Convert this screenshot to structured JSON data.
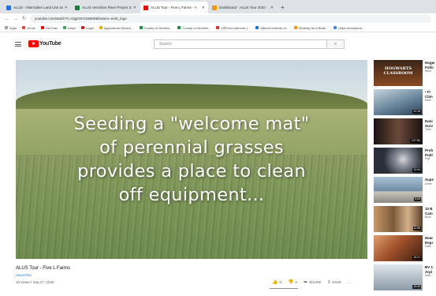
{
  "browser": {
    "tabs": [
      {
        "title": "ALUS - Alternative Land Use Ser",
        "color": "#1a73e8",
        "active": false
      },
      {
        "title": "ALUS Vermilion River Project St",
        "color": "#188038",
        "active": false
      },
      {
        "title": "ALUS Tour - Five L Farms - Y",
        "color": "#ff0000",
        "active": true
      },
      {
        "title": "Dashboard · ALUS Tour 2020",
        "color": "#f29900",
        "active": false
      }
    ],
    "url": "youtube.com/watch?v=Ojg4OHzD6EM&feature=emb_logo",
    "bookmarks": [
      "Apps",
      "Gmail",
      "YouTube",
      "Maps",
      "Login",
      "Agricultural Service...",
      "County of Vermilio...",
      "County of Vermilio...",
      "ViRCan Lakerose (...",
      "Alberta Institute of...",
      "Working for a Bette...",
      "https://sorrystore..."
    ]
  },
  "youtube": {
    "logo": "YouTube",
    "logo_sup": "CA",
    "search_placeholder": "Search"
  },
  "video": {
    "caption_lines": [
      "Seeding a \"welcome mat\"",
      "of perennial grasses",
      "provides a place to clean",
      "off equipment..."
    ],
    "title": "ALUS Tour - Five L Farms",
    "tag": "UNLISTED",
    "meta": "10 views • Sep 27, 2020",
    "actions": {
      "like": "0",
      "dislike": "0",
      "share": "SHARE",
      "save": "SAVE",
      "more": "..."
    }
  },
  "sidebar": [
    {
      "title": "Hogw",
      "line2": "Follo",
      "channel": "Wiza",
      "duration": "",
      "thumb_text": "HOGWARTS CLASSROOM",
      "thumb_color": "#8a4a22"
    },
    {
      "title": "• Fi",
      "line2": "Clim",
      "channel": "Mete",
      "duration": "12:16",
      "thumb_text": "",
      "thumb_color": "#5f7d95"
    },
    {
      "title": "Dani",
      "line2": "Surv",
      "channel": "Tamr",
      "duration": "1:07:50",
      "thumb_text": "",
      "thumb_color": "#3a2a22"
    },
    {
      "title": "Proh",
      "line2": "Publ",
      "channel": "PigF",
      "duration": "12:04",
      "thumb_text": "",
      "thumb_color": "#4f5a6a"
    },
    {
      "title": "Supe",
      "line2": "",
      "channel": "Ameri",
      "duration": "5:09",
      "thumb_text": "",
      "thumb_color": "#6f8aa3"
    },
    {
      "title": "10 B",
      "line2": "Cam",
      "channel": "Buzz",
      "duration": "11:08",
      "thumb_text": "",
      "thumb_color": "#7a5a3a"
    },
    {
      "title": "Heat",
      "line2": "Depr",
      "channel": "Mark",
      "duration": "15:21",
      "thumb_text": "",
      "thumb_color": "#a0502a"
    },
    {
      "title": "BV 1",
      "line2": "Arpl",
      "channel": "Dark",
      "duration": "13:49",
      "thumb_text": "",
      "thumb_color": "#8a9aa6"
    }
  ]
}
